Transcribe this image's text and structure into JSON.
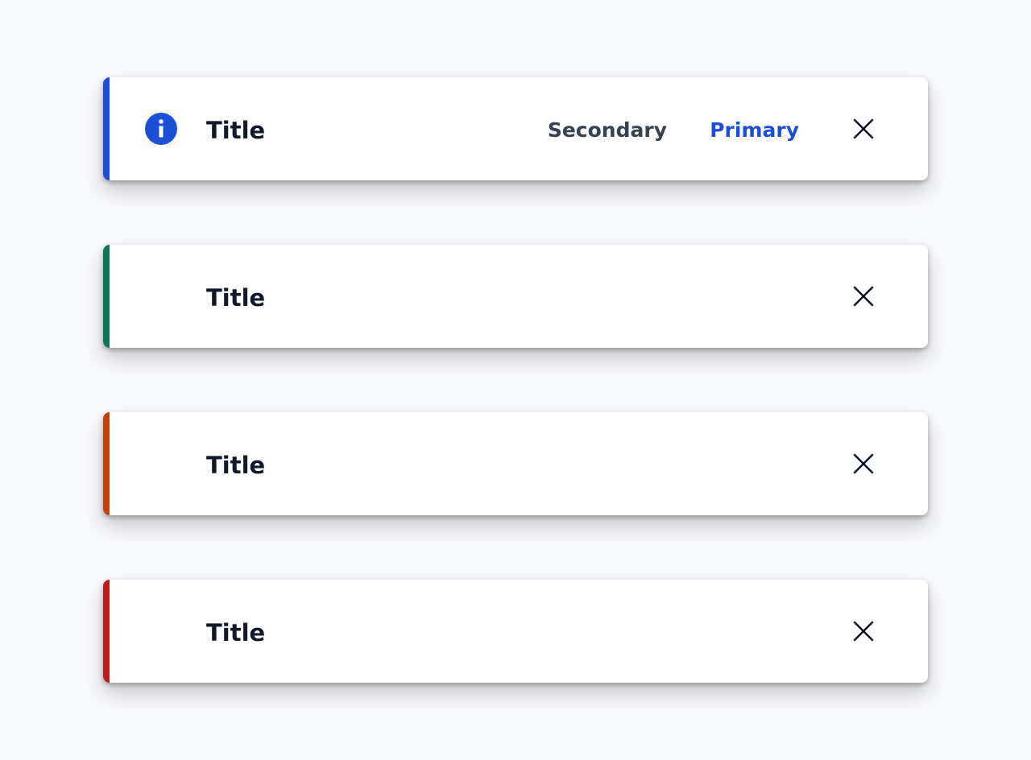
{
  "colors": {
    "info": "#1d4ed8",
    "success": "#0f7657",
    "warning": "#c2410c",
    "error": "#b91c1c",
    "title_text": "#111827",
    "secondary_text": "#374151",
    "primary_text": "#1d4ed8",
    "background": "#f8f9fb"
  },
  "toasts": [
    {
      "variant": "info",
      "icon": "info-icon",
      "title": "Title",
      "secondary_label": "Secondary",
      "primary_label": "Primary",
      "close_icon": "close-icon"
    },
    {
      "variant": "success",
      "title": "Title",
      "close_icon": "close-icon"
    },
    {
      "variant": "warning",
      "title": "Title",
      "close_icon": "close-icon"
    },
    {
      "variant": "error",
      "title": "Title",
      "close_icon": "close-icon"
    }
  ]
}
